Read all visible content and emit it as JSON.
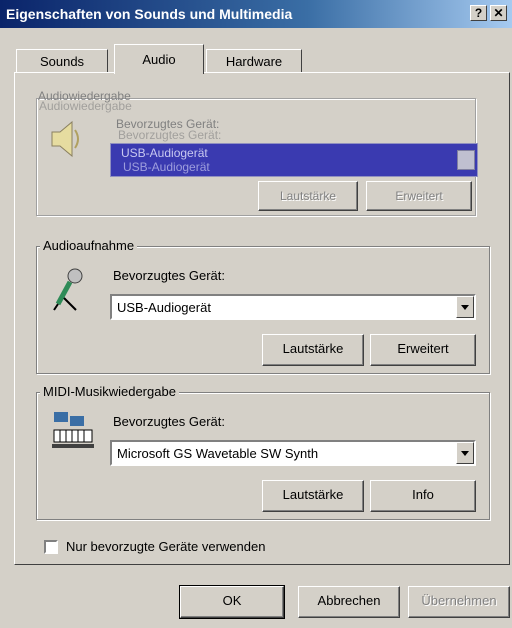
{
  "window": {
    "title": "Eigenschaften von Sounds und Multimedia",
    "help_label": "?",
    "close_label": "✕"
  },
  "tabs": [
    {
      "label": "Sounds"
    },
    {
      "label": "Audio"
    },
    {
      "label": "Hardware"
    }
  ],
  "playback": {
    "legend": "Audiowiedergabe",
    "device_label": "Bevorzugtes Gerät:",
    "device_value": "USB-Audiogerät",
    "volume_label": "Lautstärke",
    "advanced_label": "Erweitert"
  },
  "recording": {
    "legend": "Audioaufnahme",
    "device_label": "Bevorzugtes Gerät:",
    "device_value": "USB-Audiogerät",
    "volume_label": "Lautstärke",
    "advanced_label": "Erweitert",
    "icon": "microphone-icon"
  },
  "midi": {
    "legend": "MIDI-Musikwiedergabe",
    "device_label": "Bevorzugtes Gerät:",
    "device_value": "Microsoft GS Wavetable SW Synth",
    "volume_label": "Lautstärke",
    "info_label": "Info",
    "icon": "midi-keyboard-icon"
  },
  "options": {
    "preferred_only_label": "Nur bevorzugte Geräte verwenden",
    "preferred_only_checked": false
  },
  "footer": {
    "ok_label": "OK",
    "cancel_label": "Abbrechen",
    "apply_label": "Übernehmen"
  }
}
